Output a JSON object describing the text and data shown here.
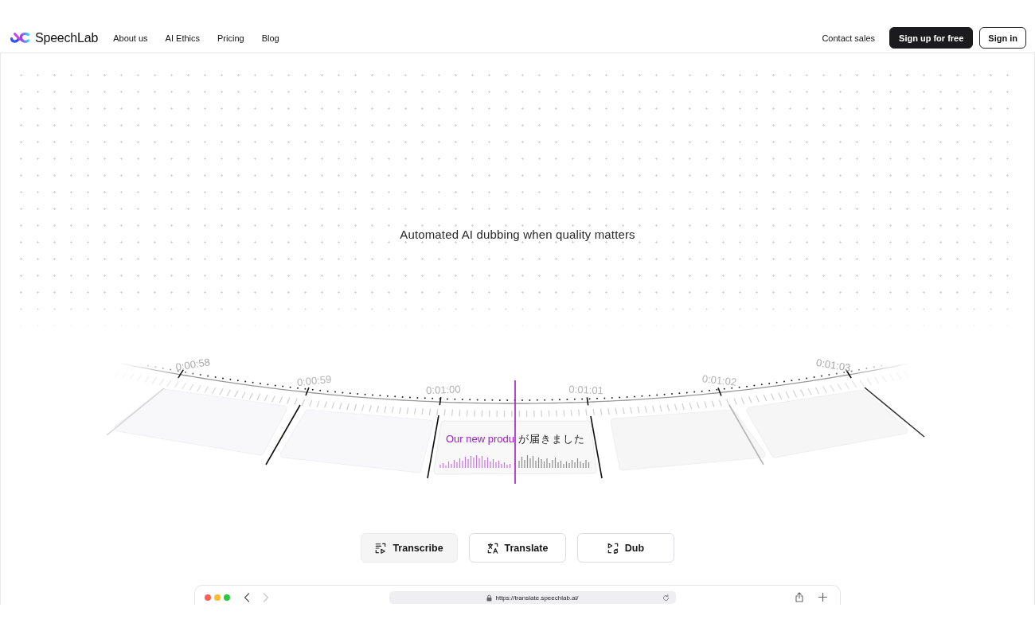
{
  "header": {
    "brand": "SpeechLab",
    "nav": [
      "About us",
      "AI Ethics",
      "Pricing",
      "Blog"
    ],
    "contact": "Contact sales",
    "signup": "Sign up for free",
    "signin": "Sign in"
  },
  "hero": {
    "title": "Automated AI dubbing when quality matters"
  },
  "timeline": {
    "timestamps": [
      "0:00:58",
      "0:00:59",
      "0:01:00",
      "0:01:01",
      "0:01:02",
      "0:01:03"
    ],
    "clips": [
      {
        "kind": "empty"
      },
      {
        "kind": "empty"
      },
      {
        "kind": "caption",
        "source_text": "Our new produ",
        "translated_text": "が届きました"
      },
      {
        "kind": "empty"
      },
      {
        "kind": "empty"
      }
    ]
  },
  "modes": [
    {
      "kind": "transcribe",
      "label": "Transcribe",
      "selected": true
    },
    {
      "kind": "translate",
      "label": "Translate",
      "selected": false
    },
    {
      "kind": "dub",
      "label": "Dub",
      "selected": false
    }
  ],
  "browser": {
    "url": "https://translate.speechlab.ai/",
    "back_disabled": false,
    "forward_disabled": true
  }
}
